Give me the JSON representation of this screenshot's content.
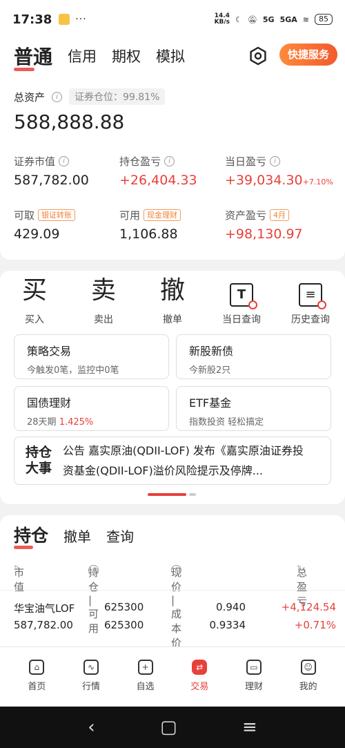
{
  "status_bar": {
    "time": "17:38",
    "dots": "···",
    "speed_value": "14.4",
    "speed_unit": "KB/s",
    "signal1": "5G",
    "signal2": "5GA",
    "battery": "85"
  },
  "header": {
    "tabs": [
      "普通",
      "信用",
      "期权",
      "模拟"
    ],
    "quick_service": "快捷服务"
  },
  "account": {
    "total_label": "总资产",
    "position_label": "证券仓位：99.81%",
    "total_value": "588,888.88",
    "market_value_label": "证券市值",
    "market_value": "587,782.00",
    "holding_pl_label": "持仓盈亏",
    "holding_pl": "+26,404.33",
    "daily_pl_label": "当日盈亏",
    "daily_pl": "+39,034.30",
    "daily_pl_pct": "+7.10%",
    "withdrawable_label": "可取",
    "bank_transfer_tag": "银证转账",
    "withdrawable": "429.09",
    "available_label": "可用",
    "cash_mgmt_tag": "现金理财",
    "available": "1,106.88",
    "asset_pl_label": "资产盈亏",
    "month_tag": "4月",
    "asset_pl": "+98,130.97"
  },
  "actions": [
    {
      "glyph": "买",
      "label": "买入"
    },
    {
      "glyph": "卖",
      "label": "卖出"
    },
    {
      "glyph": "撤",
      "label": "撤单"
    },
    {
      "glyph": "T",
      "label": "当日查询"
    },
    {
      "glyph": "≡",
      "label": "历史查询"
    }
  ],
  "cards": {
    "strategy": {
      "title": "策略交易",
      "sub": "今触发0笔，监控中0笔"
    },
    "new_stock": {
      "title": "新股新债",
      "sub": "今新股2只"
    },
    "bond": {
      "title": "国债理财",
      "sub_prefix": "28天期 ",
      "sub_rate": "1.425%"
    },
    "etf": {
      "title": "ETF基金",
      "sub": "指数投资 轻松搞定"
    }
  },
  "news": {
    "logo_line1": "持仓",
    "logo_line2": "大事",
    "text": "公告 嘉实原油(QDII-LOF) 发布《嘉实原油证券投资基金(QDII-LOF)溢价风险提示及停牌..."
  },
  "holdings": {
    "tabs": [
      "持仓",
      "撤单",
      "查询"
    ],
    "columns": {
      "market_value": "市值",
      "position": "持仓 | 可用",
      "price": "现价 | 成本价",
      "total_pl": "总盈亏"
    },
    "rows": [
      {
        "name": "华宝油气LOF",
        "market_value": "587,782.00",
        "position": "625300",
        "available": "625300",
        "price": "0.940",
        "cost": "0.9334",
        "total_pl": "+4,124.54",
        "total_pl_pct": "+0.71%"
      }
    ]
  },
  "bottom_nav": [
    {
      "label": "首页",
      "icon": "home-icon"
    },
    {
      "label": "行情",
      "icon": "chart-icon"
    },
    {
      "label": "自选",
      "icon": "plus-icon"
    },
    {
      "label": "交易",
      "icon": "swap-icon"
    },
    {
      "label": "理财",
      "icon": "wallet-icon"
    },
    {
      "label": "我的",
      "icon": "user-icon"
    }
  ],
  "colors": {
    "accent": "#e8403a",
    "orange": "#f08234"
  }
}
